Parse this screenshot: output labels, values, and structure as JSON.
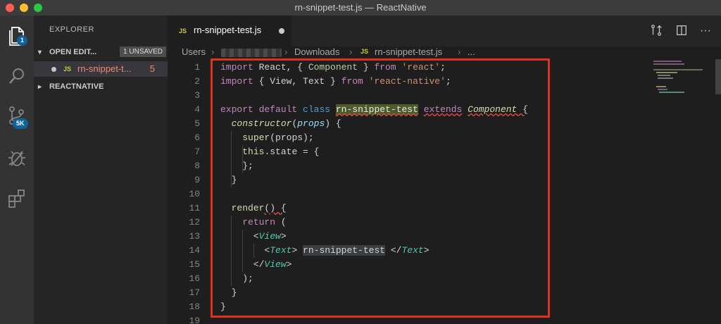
{
  "window": {
    "title": "rn-snippet-test.js — ReactNative"
  },
  "activity_bar": {
    "explorer_badge": "1",
    "scm_badge": "5K"
  },
  "sidebar": {
    "title": "EXPLORER",
    "open_editors_label": "OPEN EDIT...",
    "unsaved_label": "1 UNSAVED",
    "file": {
      "name": "rn-snippet-t...",
      "type": "JS",
      "problems": "5"
    },
    "folder_label": "REACTNATIVE"
  },
  "tab": {
    "type": "JS",
    "name": "rn-snippet-test.js"
  },
  "breadcrumb": {
    "items": [
      "Users",
      "Downloads",
      "rn-snippet-test.js",
      "..."
    ],
    "file_type": "JS",
    "separator": "›"
  },
  "editor": {
    "line_numbers": [
      "1",
      "2",
      "3",
      "4",
      "5",
      "6",
      "7",
      "8",
      "9",
      "10",
      "11",
      "12",
      "13",
      "14",
      "15",
      "16",
      "17",
      "18",
      "19"
    ],
    "lines": [
      [
        "import",
        " React, { ",
        "Component",
        " } ",
        "from",
        " ",
        "'react'",
        ";"
      ],
      [
        "import",
        " { View, Text } ",
        "from",
        " ",
        "'react-native'",
        ";"
      ],
      [],
      [
        "export",
        " ",
        "default",
        " ",
        "class",
        " ",
        "rn-snippet-test",
        " ",
        "extends",
        " ",
        "Component",
        " {"
      ],
      [
        "  ",
        "constructor",
        "(",
        "props",
        ") {"
      ],
      [
        "    ",
        "super",
        "(props);"
      ],
      [
        "    ",
        "this",
        ".state = {"
      ],
      [
        "    };"
      ],
      [
        "  }"
      ],
      [],
      [
        "  ",
        "render",
        "() {"
      ],
      [
        "    ",
        "return",
        " ("
      ],
      [
        "      <",
        "View",
        ">"
      ],
      [
        "        <",
        "Text",
        "> ",
        "rn-snippet-test",
        " </",
        "Text",
        ">"
      ],
      [
        "      </",
        "View",
        ">"
      ],
      [
        "    );"
      ],
      [
        "  }"
      ],
      [
        "}"
      ]
    ]
  },
  "colors": {
    "highlight_border": "#e0301e",
    "accent": "#0e639c"
  }
}
